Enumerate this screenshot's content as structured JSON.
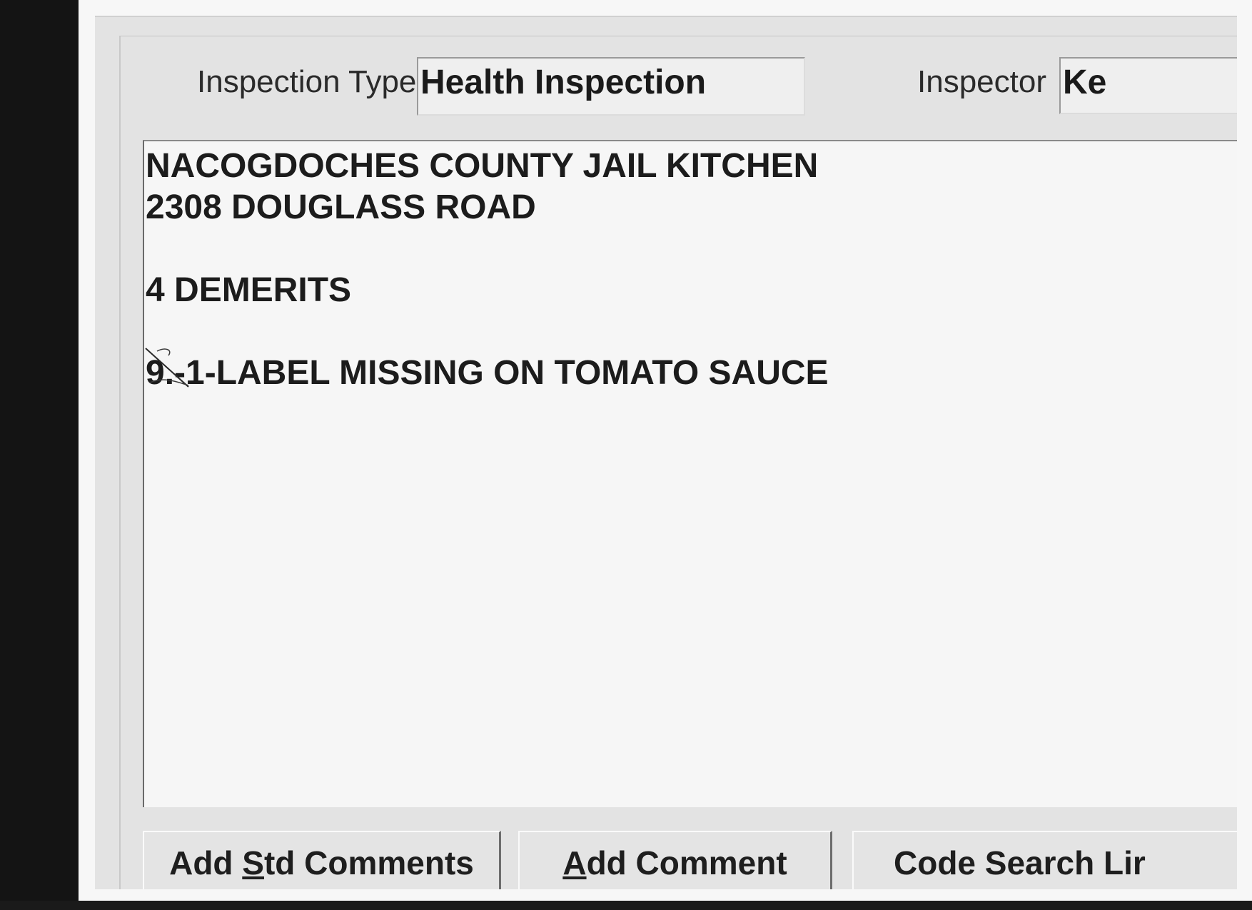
{
  "header": {
    "inspection_type_label": "Inspection Type",
    "inspection_type_value": "Health Inspection",
    "inspector_label": "Inspector",
    "inspector_value": "Ke"
  },
  "comments": {
    "lines": [
      "NACOGDOCHES COUNTY JAIL KITCHEN",
      "2308 DOUGLASS ROAD",
      "",
      "4 DEMERITS",
      "",
      "9.-1-LABEL MISSING ON TOMATO SAUCE"
    ]
  },
  "buttons": {
    "add_std_comments": {
      "pre": "Add ",
      "hotkey": "S",
      "post": "td Comments"
    },
    "add_comment": {
      "pre": "",
      "hotkey": "A",
      "post": "dd Comment"
    },
    "code_search": {
      "label": "Code Search Lir"
    }
  }
}
